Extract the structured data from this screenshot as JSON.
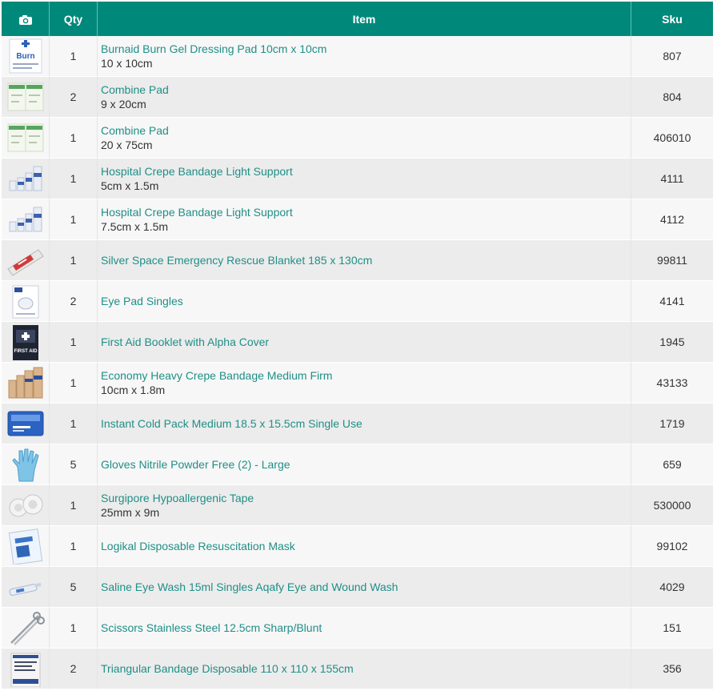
{
  "header": {
    "photo_icon": "camera-icon",
    "qty": "Qty",
    "item": "Item",
    "sku": "Sku"
  },
  "rows": [
    {
      "qty": "1",
      "name": "Burnaid Burn Gel Dressing Pad 10cm x 10cm",
      "size": "10 x 10cm",
      "sku": "807",
      "thumb": "burn-dressing"
    },
    {
      "qty": "2",
      "name": "Combine Pad",
      "size": "9 x 20cm",
      "sku": "804",
      "thumb": "combine-pad"
    },
    {
      "qty": "1",
      "name": "Combine Pad",
      "size": "20 x 75cm",
      "sku": "406010",
      "thumb": "combine-pad"
    },
    {
      "qty": "1",
      "name": "Hospital Crepe Bandage Light Support",
      "size": "5cm x 1.5m",
      "sku": "4111",
      "thumb": "bandage-rolls"
    },
    {
      "qty": "1",
      "name": "Hospital Crepe Bandage Light Support",
      "size": "7.5cm x 1.5m",
      "sku": "4112",
      "thumb": "bandage-rolls"
    },
    {
      "qty": "1",
      "name": "Silver Space Emergency Rescue Blanket 185 x 130cm",
      "size": "",
      "sku": "99811",
      "thumb": "rescue-blanket"
    },
    {
      "qty": "2",
      "name": "Eye Pad Singles",
      "size": "",
      "sku": "4141",
      "thumb": "eye-pad"
    },
    {
      "qty": "1",
      "name": "First Aid Booklet with Alpha Cover",
      "size": "",
      "sku": "1945",
      "thumb": "booklet"
    },
    {
      "qty": "1",
      "name": "Economy Heavy Crepe Bandage Medium Firm",
      "size": "10cm x 1.8m",
      "sku": "43133",
      "thumb": "crepe-bandage"
    },
    {
      "qty": "1",
      "name": "Instant Cold Pack Medium 18.5 x 15.5cm Single Use",
      "size": "",
      "sku": "1719",
      "thumb": "cold-pack"
    },
    {
      "qty": "5",
      "name": "Gloves Nitrile Powder Free (2) - Large",
      "size": "",
      "sku": "659",
      "thumb": "glove"
    },
    {
      "qty": "1",
      "name": "Surgipore Hypoallergenic Tape",
      "size": "25mm x 9m",
      "sku": "530000",
      "thumb": "tape"
    },
    {
      "qty": "1",
      "name": "Logikal Disposable Resuscitation Mask",
      "size": "",
      "sku": "99102",
      "thumb": "mask-pack"
    },
    {
      "qty": "5",
      "name": "Saline Eye Wash 15ml Singles Aqafy Eye and Wound Wash",
      "size": "",
      "sku": "4029",
      "thumb": "eye-wash"
    },
    {
      "qty": "1",
      "name": "Scissors Stainless Steel 12.5cm Sharp/Blunt",
      "size": "",
      "sku": "151",
      "thumb": "scissors"
    },
    {
      "qty": "2",
      "name": "Triangular Bandage Disposable 110 x 110 x 155cm",
      "size": "",
      "sku": "356",
      "thumb": "triangular-bandage"
    }
  ],
  "colors": {
    "header_bg": "#00897b",
    "link": "#1f8f87",
    "row_odd": "#f7f7f7",
    "row_even": "#ececec"
  }
}
